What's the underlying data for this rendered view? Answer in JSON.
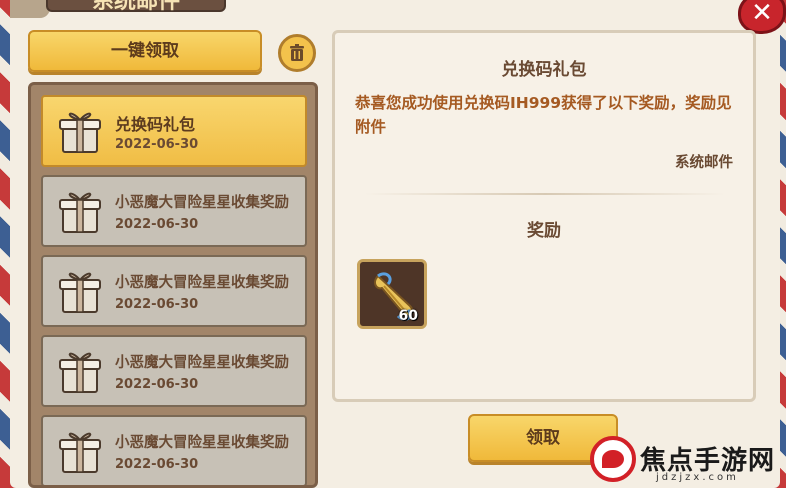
{
  "window": {
    "title": "系统邮件",
    "close_icon": "close-icon"
  },
  "toolbar": {
    "onekey_label": "一键领取",
    "trash_icon": "trash-icon"
  },
  "mail_list": [
    {
      "title": "兑换码礼包",
      "date": "2022-06-30",
      "active": true,
      "icon": "gift-box-icon"
    },
    {
      "title": "小恶魔大冒险星星收集奖励",
      "date": "2022-06-30",
      "active": false,
      "icon": "gift-box-icon"
    },
    {
      "title": "小恶魔大冒险星星收集奖励",
      "date": "2022-06-30",
      "active": false,
      "icon": "gift-box-icon"
    },
    {
      "title": "小恶魔大冒险星星收集奖励",
      "date": "2022-06-30",
      "active": false,
      "icon": "gift-box-icon"
    },
    {
      "title": "小恶魔大冒险星星收集奖励",
      "date": "2022-06-30",
      "active": false,
      "icon": "gift-box-icon"
    }
  ],
  "detail": {
    "title": "兑换码礼包",
    "body": "恭喜您成功使用兑换码IH999获得了以下奖励，奖励见附件",
    "sender": "系统邮件",
    "reward_heading": "奖励",
    "rewards": [
      {
        "icon": "scroll-icon",
        "count": "60"
      }
    ],
    "claim_label": "领取"
  },
  "watermark": {
    "text": "焦点手游网",
    "sub": "jdzjzx.com"
  },
  "colors": {
    "accent": "#f0b93a",
    "title_text": "#6a4a33",
    "body_text": "#a55a22",
    "close": "#c8252c"
  }
}
